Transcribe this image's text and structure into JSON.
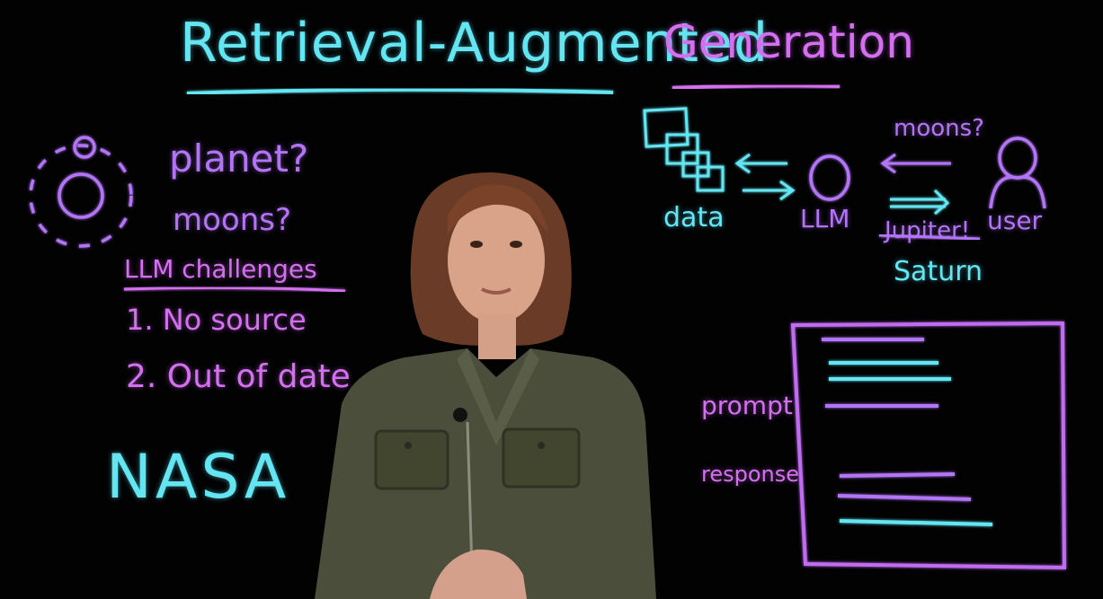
{
  "title": {
    "part1": "Retrieval-Augmented",
    "part2": "Generation"
  },
  "left": {
    "q1": "planet?",
    "q2": "moons?",
    "challenges_heading": "LLM challenges",
    "challenge1": "1. No source",
    "challenge2": "2. Out of date",
    "nasa": "NASA"
  },
  "diagram": {
    "data_label": "data",
    "llm_label": "LLM",
    "user_label": "user",
    "moons_q": "moons?",
    "old_answer": "Jupiter!",
    "new_answer": "Saturn"
  },
  "prompt_box": {
    "prompt_label": "prompt",
    "response_label": "response"
  },
  "icons": {
    "planet": "planet-with-moons-icon",
    "documents": "stacked-documents-icon",
    "llm": "circle-llm-icon",
    "user": "person-icon",
    "presenter": "presenter-silhouette"
  },
  "colors": {
    "background": "#020203",
    "cyan": "#63e6f2",
    "purple": "#b274f5",
    "magenta": "#d46ff0"
  }
}
